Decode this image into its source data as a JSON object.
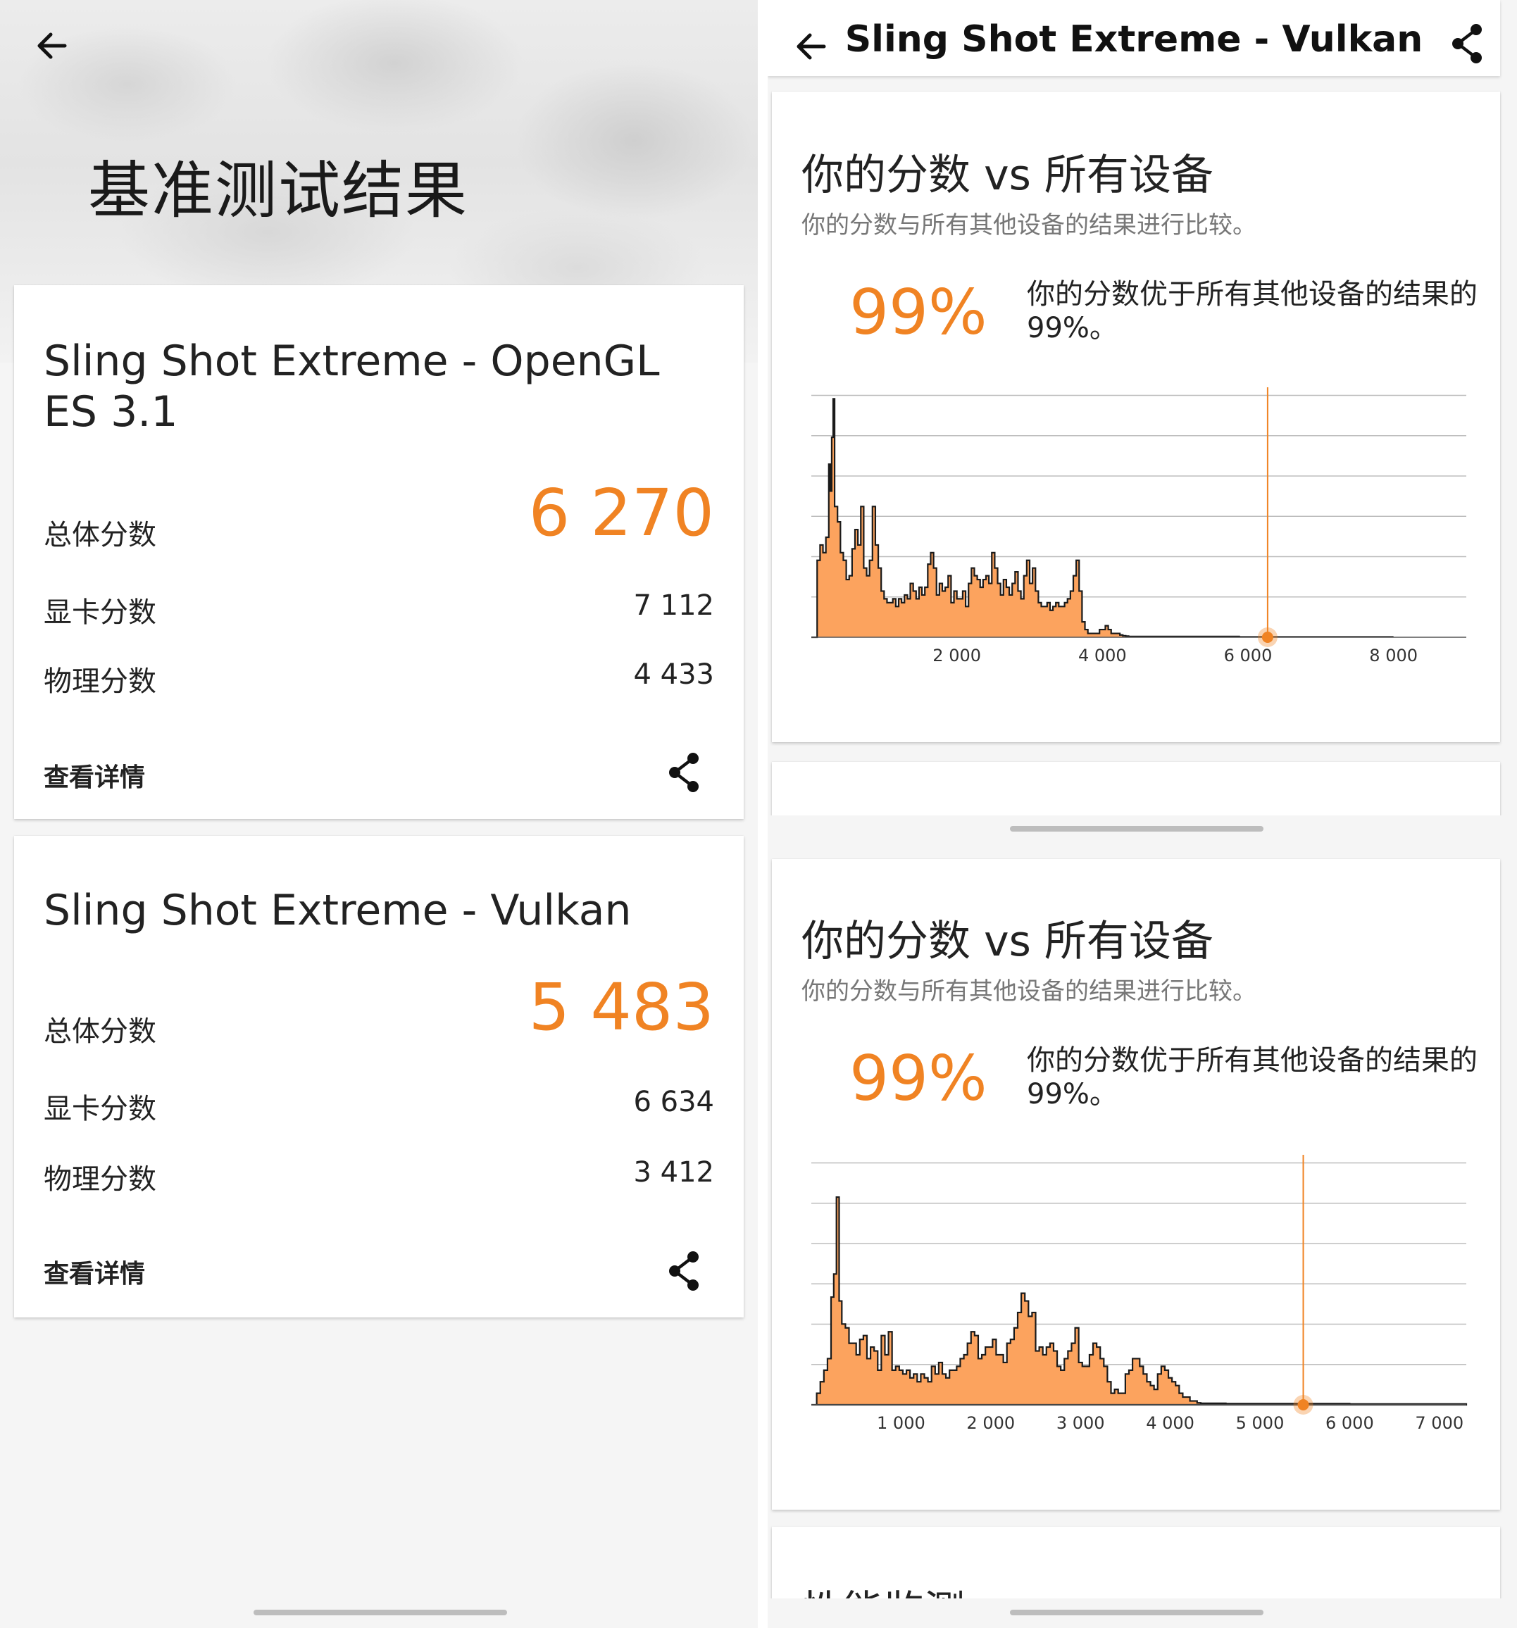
{
  "left": {
    "hero_title": "基准测试结果",
    "cards": [
      {
        "title": "Sling Shot Extreme - OpenGL ES 3.1",
        "overall_label": "总体分数",
        "overall_value": "6 270",
        "graphics_label": "显卡分数",
        "graphics_value": "7 112",
        "physics_label": "物理分数",
        "physics_value": "4 433",
        "details_label": "查看详情"
      },
      {
        "title": "Sling Shot Extreme - Vulkan",
        "overall_label": "总体分数",
        "overall_value": "5 483",
        "graphics_label": "显卡分数",
        "graphics_value": "6 634",
        "physics_label": "物理分数",
        "physics_value": "3 412",
        "details_label": "查看详情"
      }
    ]
  },
  "right": {
    "appbar_title": "Sling Shot Extreme - Vulkan",
    "comparisons": [
      {
        "title": "你的分数 vs 所有设备",
        "subtitle": "你的分数与所有其他设备的结果进行比较。",
        "percentile": "99%",
        "description": "你的分数优于所有其他设备的结果的 99%。"
      },
      {
        "title": "你的分数 vs 所有设备",
        "subtitle": "你的分数与所有其他设备的结果进行比较。",
        "percentile": "99%",
        "description": "你的分数优于所有其他设备的结果的 99%。"
      }
    ],
    "next_section_title": "性能监测"
  },
  "icons": [
    "back-arrow-icon",
    "share-icon"
  ],
  "colors": {
    "accent": "#f08323",
    "fill": "#fca35e",
    "grid": "#bdbdbd"
  },
  "chart_data": [
    {
      "type": "area",
      "title": "",
      "xlabel": "",
      "ylabel": "",
      "xlim": [
        0,
        9000
      ],
      "xticks": [
        2000,
        4000,
        6000,
        8000
      ],
      "xtick_labels": [
        "2 000",
        "4 000",
        "6 000",
        "8 000"
      ],
      "grid": true,
      "marker_x": 6270,
      "x": [
        0,
        80,
        120,
        160,
        200,
        240,
        260,
        280,
        300,
        320,
        360,
        400,
        440,
        480,
        520,
        560,
        600,
        640,
        680,
        720,
        760,
        800,
        840,
        880,
        920,
        960,
        1000,
        1040,
        1080,
        1120,
        1160,
        1200,
        1240,
        1280,
        1320,
        1360,
        1400,
        1440,
        1480,
        1520,
        1560,
        1600,
        1640,
        1680,
        1720,
        1760,
        1800,
        1840,
        1880,
        1920,
        1960,
        2000,
        2040,
        2080,
        2120,
        2160,
        2200,
        2240,
        2280,
        2320,
        2360,
        2400,
        2440,
        2480,
        2520,
        2560,
        2600,
        2640,
        2680,
        2720,
        2760,
        2800,
        2840,
        2880,
        2920,
        2960,
        3000,
        3040,
        3080,
        3120,
        3160,
        3200,
        3240,
        3280,
        3320,
        3360,
        3400,
        3440,
        3480,
        3520,
        3560,
        3600,
        3640,
        3680,
        3720,
        3760,
        3800,
        3840,
        3880,
        3920,
        3960,
        4000,
        4040,
        4080,
        4120,
        4160,
        4200,
        4240,
        4280,
        4320,
        4360,
        4400,
        4440,
        4480,
        4520,
        4560,
        4600,
        4640,
        4680,
        4720,
        4760,
        4800,
        4840,
        4880,
        4920,
        4960,
        5000,
        5040,
        5080,
        5120,
        5160,
        5200,
        5240,
        5280,
        5320,
        5360,
        5400,
        5440,
        5480,
        5520,
        5560,
        5600,
        5640,
        5680,
        5720,
        5760,
        5800,
        5840,
        5880,
        5920,
        5960,
        6000,
        6100,
        6200,
        6300,
        6400,
        6600,
        6800,
        7000,
        7500,
        8000,
        8500,
        9000
      ],
      "y": [
        0,
        20,
        24,
        22,
        26,
        45,
        38,
        52,
        62,
        34,
        30,
        22,
        20,
        15,
        16,
        23,
        28,
        24,
        34,
        18,
        16,
        20,
        34,
        24,
        18,
        12,
        10,
        9,
        9,
        10,
        8,
        10,
        9,
        11,
        10,
        14,
        12,
        10,
        13,
        11,
        13,
        19,
        22,
        18,
        11,
        14,
        12,
        13,
        16,
        9,
        12,
        10,
        10,
        12,
        8,
        14,
        18,
        16,
        15,
        13,
        15,
        16,
        14,
        22,
        18,
        14,
        11,
        15,
        13,
        11,
        14,
        17,
        12,
        10,
        16,
        20,
        14,
        18,
        12,
        9,
        8,
        8,
        9,
        7,
        8,
        9,
        8,
        8,
        9,
        10,
        12,
        16,
        20,
        12,
        4,
        2,
        1,
        1,
        1,
        1,
        2,
        2,
        3,
        2,
        1,
        1,
        1,
        0.6,
        0.4,
        0.3,
        0.2,
        0.2,
        0.2,
        0.2,
        0.2,
        0.2,
        0.2,
        0.2,
        0.2,
        0.2,
        0.2,
        0.2,
        0.2,
        0.2,
        0.2,
        0.2,
        0.2,
        0.2,
        0.2,
        0.2,
        0.2,
        0.2,
        0.2,
        0.2,
        0.2,
        0.2,
        0.2,
        0.2,
        0.2,
        0.2,
        0.2,
        0.2,
        0.2,
        0.2,
        0.2,
        0.2,
        0.2,
        0.2,
        0.1,
        0.1,
        0.1,
        0.1,
        0.1,
        0.1,
        0.1,
        0.1,
        0.1,
        0.1,
        0.1,
        0.1
      ]
    },
    {
      "type": "area",
      "title": "",
      "xlabel": "",
      "ylabel": "",
      "xlim": [
        0,
        7300
      ],
      "xticks": [
        1000,
        2000,
        3000,
        4000,
        5000,
        6000,
        7000
      ],
      "xtick_labels": [
        "1 000",
        "2 000",
        "3 000",
        "4 000",
        "5 000",
        "6 000",
        "7 000"
      ],
      "grid": true,
      "marker_x": 5483,
      "x": [
        0,
        60,
        100,
        140,
        180,
        220,
        250,
        280,
        310,
        340,
        380,
        420,
        460,
        500,
        540,
        580,
        620,
        660,
        700,
        740,
        780,
        820,
        860,
        900,
        940,
        980,
        1020,
        1060,
        1100,
        1140,
        1180,
        1220,
        1260,
        1300,
        1340,
        1380,
        1420,
        1460,
        1500,
        1540,
        1580,
        1620,
        1660,
        1700,
        1740,
        1780,
        1820,
        1860,
        1900,
        1940,
        1980,
        2020,
        2060,
        2100,
        2140,
        2180,
        2220,
        2260,
        2300,
        2340,
        2380,
        2420,
        2460,
        2500,
        2540,
        2580,
        2620,
        2660,
        2700,
        2740,
        2780,
        2820,
        2860,
        2900,
        2940,
        2980,
        3020,
        3060,
        3100,
        3140,
        3180,
        3220,
        3260,
        3300,
        3340,
        3380,
        3420,
        3460,
        3500,
        3540,
        3580,
        3620,
        3660,
        3700,
        3740,
        3780,
        3820,
        3860,
        3900,
        3940,
        3980,
        4020,
        4060,
        4100,
        4140,
        4180,
        4220,
        4260,
        4300,
        4340,
        4380,
        4420,
        4460,
        4500,
        4540,
        4580,
        4620,
        4660,
        4700,
        4740,
        4780,
        4820,
        4860,
        4900,
        4940,
        4980,
        5020,
        5060,
        5100,
        5140,
        5180,
        5220,
        5260,
        5300,
        5340,
        5380,
        5420,
        5460,
        5500,
        5600,
        5700,
        5800,
        6000,
        6200,
        6400,
        6600,
        6800,
        7000,
        7300
      ],
      "y": [
        0,
        3,
        6,
        9,
        12,
        28,
        34,
        54,
        27,
        21,
        20,
        16,
        16,
        13,
        17,
        18,
        12,
        15,
        14,
        9,
        18,
        13,
        19,
        9,
        10,
        9,
        8,
        9,
        7,
        8,
        6,
        8,
        7,
        6,
        10,
        8,
        11,
        8,
        7,
        9,
        9,
        10,
        12,
        13,
        16,
        19,
        18,
        12,
        13,
        15,
        15,
        17,
        13,
        13,
        11,
        16,
        17,
        20,
        24,
        29,
        27,
        23,
        24,
        14,
        15,
        13,
        15,
        16,
        14,
        10,
        9,
        12,
        14,
        16,
        20,
        11,
        10,
        10,
        13,
        16,
        15,
        12,
        10,
        6,
        3,
        4,
        3,
        3,
        8,
        9,
        12,
        12,
        10,
        8,
        6,
        5,
        4,
        8,
        10,
        9,
        7,
        6,
        5,
        3,
        2,
        2,
        1,
        1,
        0.5,
        0.4,
        0.4,
        0.4,
        0.4,
        0.4,
        0.4,
        0.4,
        0.3,
        0.3,
        0.3,
        0.3,
        0.3,
        0.3,
        0.3,
        0.3,
        0.3,
        0.3,
        0.3,
        0.3,
        0.3,
        0.3,
        0.3,
        0.3,
        0.3,
        0.3,
        0.3,
        0.3,
        0.3,
        0.3,
        0.3,
        0.3,
        0.3,
        0.3,
        0.2,
        0.2,
        0.2,
        0.2,
        0.2,
        0.2,
        0.2,
        0.1
      ]
    }
  ]
}
